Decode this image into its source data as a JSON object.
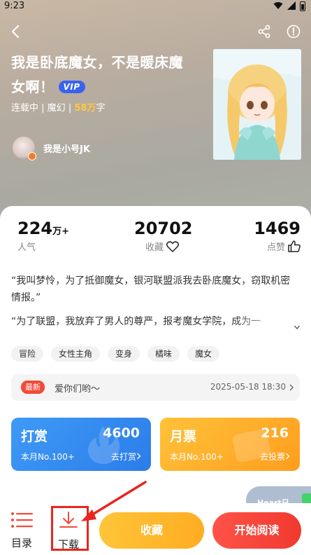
{
  "status_bar": {
    "time": "9:23"
  },
  "book": {
    "title": "我是卧底魔女，不是暖床魔女啊！",
    "vip_label": "VIP",
    "status": "连载中",
    "genre": "魔幻",
    "word_count": "58万",
    "word_unit": "字",
    "meta_sep": " | ",
    "author": "我是小号JK"
  },
  "stats": {
    "popularity": {
      "value": "224",
      "unit": "万+",
      "label": "人气"
    },
    "favorites": {
      "value": "20702",
      "label": "收藏"
    },
    "likes": {
      "value": "1469",
      "label": "点赞"
    }
  },
  "synopsis": {
    "para1": "“我叫梦怜，为了抵御魔女，银河联盟派我去卧底魔女，窃取机密情报。”",
    "para2": "“为了联盟，我放弃了男人的尊严，报考魔女学院，成为一"
  },
  "tags": [
    "冒险",
    "女性主角",
    "变身",
    "橘味",
    "魔女"
  ],
  "news": {
    "badge": "最新",
    "text": "爱你们哟～",
    "time": "2025-05-18 18:30"
  },
  "reward": {
    "title": "打赏",
    "value": "4600",
    "rank": "本月No.100+",
    "action": "去打赏",
    "color": "#2f86ee"
  },
  "monthly_ticket": {
    "title": "月票",
    "value": "216",
    "rank": "本月No.100+",
    "action": "去投票",
    "color": "#ffaa25"
  },
  "floating": {
    "label": "Heart日"
  },
  "bottom_bar": {
    "catalog_label": "目录",
    "download_label": "下载",
    "favorite_label": "收藏",
    "read_label": "开始阅读"
  },
  "accent_colors": {
    "highlight": "#e8261f",
    "primary": "#f0392f",
    "gold": "#ffc93c"
  }
}
